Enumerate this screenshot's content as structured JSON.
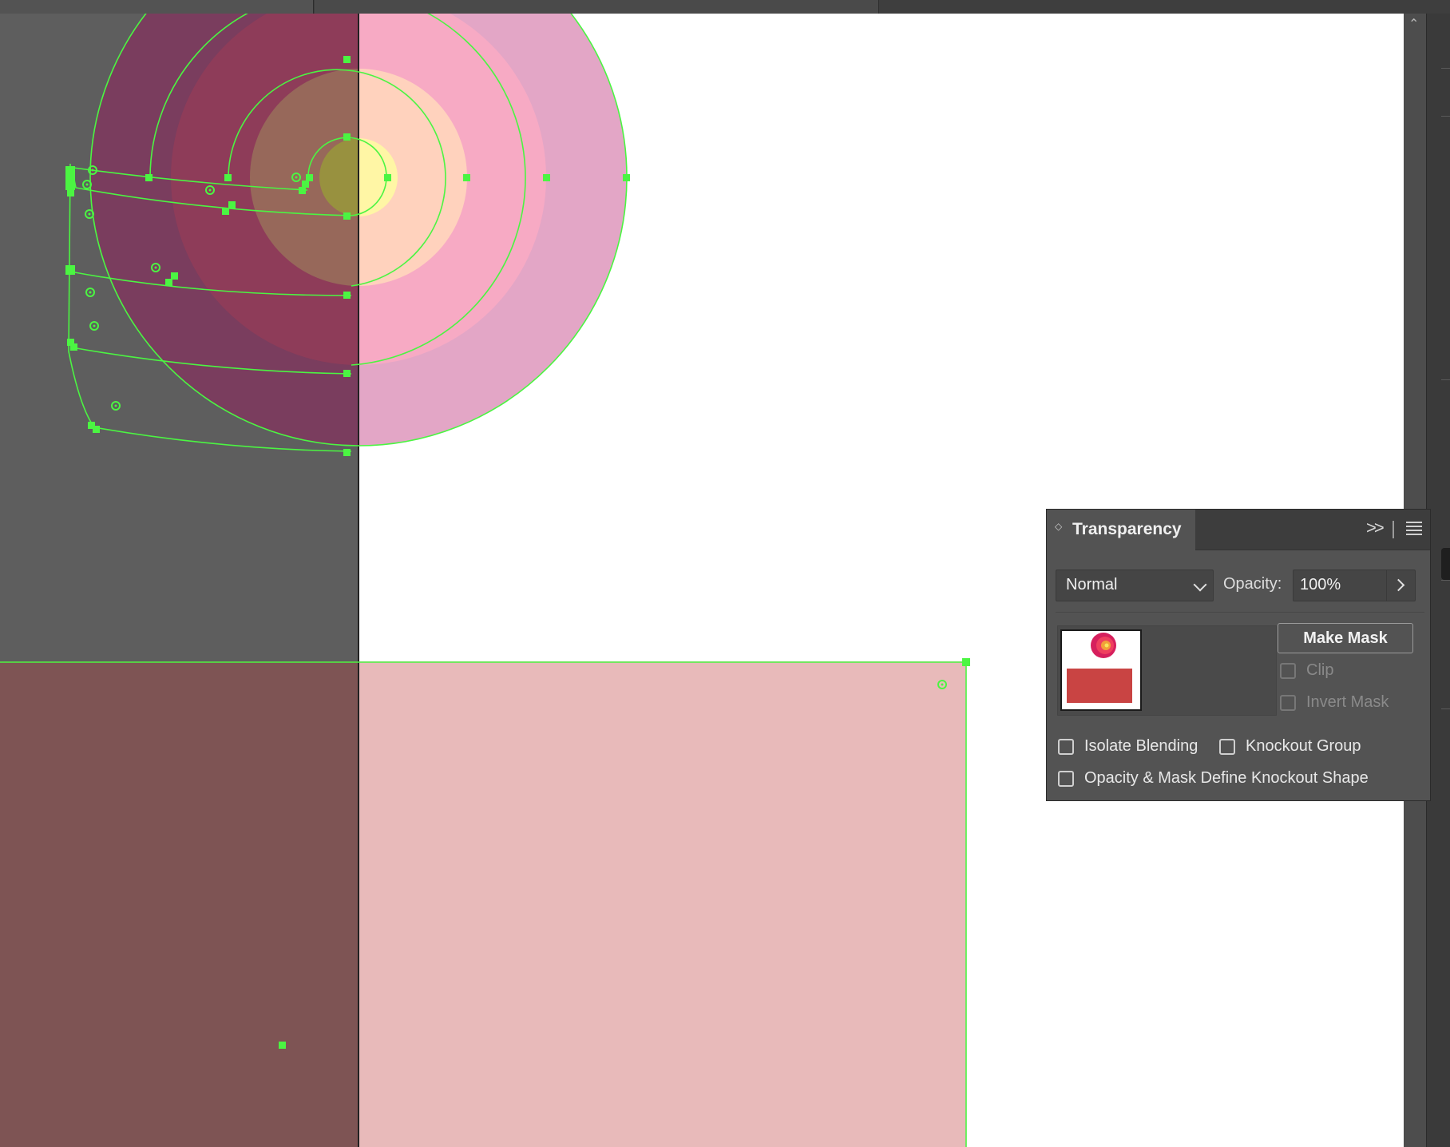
{
  "panel": {
    "title": "Transparency",
    "blend_mode": "Normal",
    "opacity_label": "Opacity:",
    "opacity_value": "100%",
    "make_mask_label": "Make Mask",
    "clip_label": "Clip",
    "invert_mask_label": "Invert Mask",
    "isolate_blending_label": "Isolate Blending",
    "knockout_group_label": "Knockout Group",
    "opacity_mask_knockout_label": "Opacity & Mask Define Knockout Shape",
    "clip_checked": false,
    "invert_mask_checked": false,
    "isolate_blending_checked": false,
    "knockout_group_checked": false,
    "opacity_mask_knockout_checked": false
  },
  "icons": {
    "panel_swap": "up-down-arrows-icon",
    "collapse": "double-chevron-right-icon",
    "menu": "hamburger-menu-icon",
    "blend_dropdown": "chevron-down-icon",
    "opacity_stepper": "chevron-right-icon",
    "scroll_up": "chevron-up-icon"
  },
  "colors": {
    "selection_path": "#4bf542",
    "canvas_dark": "#5e5e5e",
    "canvas_light": "#ffffff",
    "rect_left": "#7e5454",
    "rect_right": "#e8baba",
    "arc_outer_left": "#7a3d5e",
    "arc_2_left": "#8e3c59",
    "arc_3_left": "#97685a",
    "arc_inner_left": "#98913f",
    "arc_outer_right": "#e3a6c6",
    "arc_2_right": "#f7aac4",
    "arc_3_right": "#ffd2bd",
    "arc_inner_right": "#fff6a5",
    "panel_bg": "#535353",
    "mask_rect": "#c94443"
  }
}
